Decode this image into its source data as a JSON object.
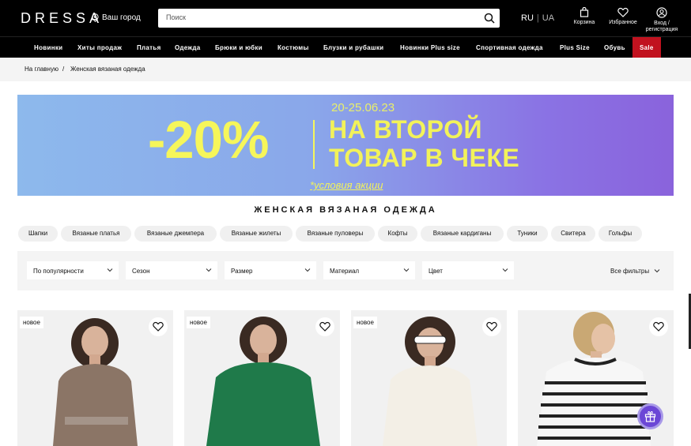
{
  "header": {
    "logo": "DRESSA",
    "city": "Ваш город",
    "search_placeholder": "Поиск",
    "lang_ru": "RU",
    "lang_sep": "|",
    "lang_ua": "UA",
    "cart": "Корзина",
    "favorites": "Избранное",
    "login_line1": "Вход /",
    "login_line2": "регистрация"
  },
  "nav": [
    "Новинки",
    "Хиты продаж",
    "Платья",
    "Одежда",
    "Брюки и юбки",
    "Костюмы",
    "Блузки и рубашки",
    "Новинки Plus size",
    "Спортивная одежда",
    "Plus Size",
    "Обувь",
    "Sale"
  ],
  "breadcrumbs": {
    "home": "На главную",
    "sep": "/",
    "current": "Женская вязаная одежда"
  },
  "banner": {
    "dates": "20-25.06.23",
    "percent": "-20%",
    "line1": "НА ВТОРОЙ",
    "line2": "ТОВАР В ЧЕКЕ",
    "conditions": "*условия акции",
    "colors": {
      "start": "#8db9ec",
      "end": "#8a63dc",
      "text": "#f6f65a"
    }
  },
  "page_title": "ЖЕНСКАЯ ВЯЗАНАЯ ОДЕЖДА",
  "chips": [
    "Шапки",
    "Вязаные платья",
    "Вязаные джемпера",
    "Вязаные жилеты",
    "Вязаные пуловеры",
    "Кофты",
    "Вязаные кардиганы",
    "Туники",
    "Свитера",
    "Гольфы"
  ],
  "filters": {
    "sort": "По популярности",
    "season": "Сезон",
    "size": "Размер",
    "material": "Материал",
    "color": "Цвет",
    "all": "Все фильтры"
  },
  "products": [
    {
      "badge": "новое",
      "shirt_color": "#8b7566"
    },
    {
      "badge": "новое",
      "shirt_color": "#1f7a4a"
    },
    {
      "badge": "новое",
      "shirt_color": "#f3efe6"
    },
    {
      "badge": "",
      "shirt_color": "#f7f7f7"
    }
  ],
  "icons": {
    "location": "location-pin-icon",
    "search": "search-icon",
    "cart": "shopping-bag-icon",
    "favorites": "heart-icon",
    "user": "user-icon",
    "chevron": "chevron-down-icon",
    "gift": "gift-icon"
  }
}
